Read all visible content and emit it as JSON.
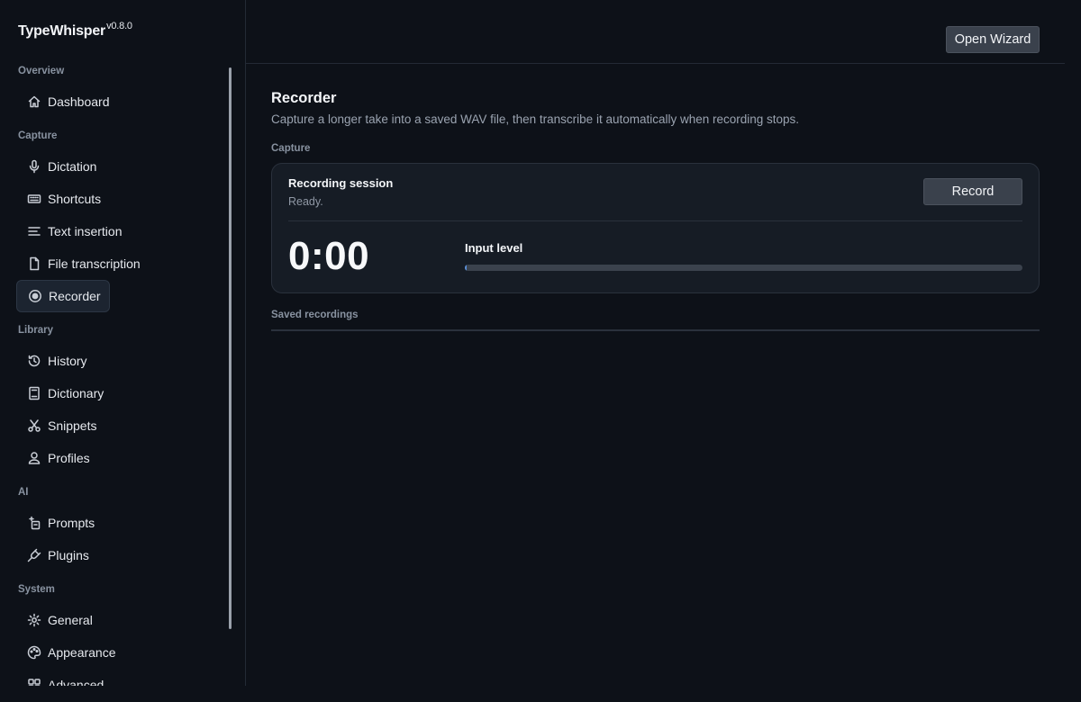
{
  "app": {
    "name": "TypeWhisper",
    "version": "v0.8.0"
  },
  "sidebar": {
    "sections": [
      {
        "label": "Overview",
        "items": [
          {
            "label": "Dashboard",
            "icon": "home-icon"
          }
        ]
      },
      {
        "label": "Capture",
        "items": [
          {
            "label": "Dictation",
            "icon": "microphone-icon"
          },
          {
            "label": "Shortcuts",
            "icon": "keyboard-icon"
          },
          {
            "label": "Text insertion",
            "icon": "text-lines-icon"
          },
          {
            "label": "File transcription",
            "icon": "file-icon"
          },
          {
            "label": "Recorder",
            "icon": "record-icon",
            "active": true
          }
        ]
      },
      {
        "label": "Library",
        "items": [
          {
            "label": "History",
            "icon": "history-icon"
          },
          {
            "label": "Dictionary",
            "icon": "book-icon"
          },
          {
            "label": "Snippets",
            "icon": "scissors-icon"
          },
          {
            "label": "Profiles",
            "icon": "user-icon"
          }
        ]
      },
      {
        "label": "AI",
        "items": [
          {
            "label": "Prompts",
            "icon": "sparkle-icon"
          },
          {
            "label": "Plugins",
            "icon": "plug-icon"
          }
        ]
      },
      {
        "label": "System",
        "items": [
          {
            "label": "General",
            "icon": "gear-icon"
          },
          {
            "label": "Appearance",
            "icon": "palette-icon"
          },
          {
            "label": "Advanced",
            "icon": "advanced-icon"
          }
        ]
      }
    ]
  },
  "header": {
    "wizard_label": "Open Wizard"
  },
  "main": {
    "title": "Recorder",
    "subtitle": "Capture a longer take into a saved WAV file, then transcribe it automatically when recording stops.",
    "capture_label": "Capture",
    "session": {
      "title": "Recording session",
      "status": "Ready.",
      "record_label": "Record",
      "timer": "0:00",
      "input_level_label": "Input level",
      "input_level": 0
    },
    "saved_label": "Saved recordings"
  },
  "colors": {
    "background": "#0d1118",
    "card": "#161c25",
    "button": "#3a414c",
    "level_fill": "#5b8fd8"
  }
}
